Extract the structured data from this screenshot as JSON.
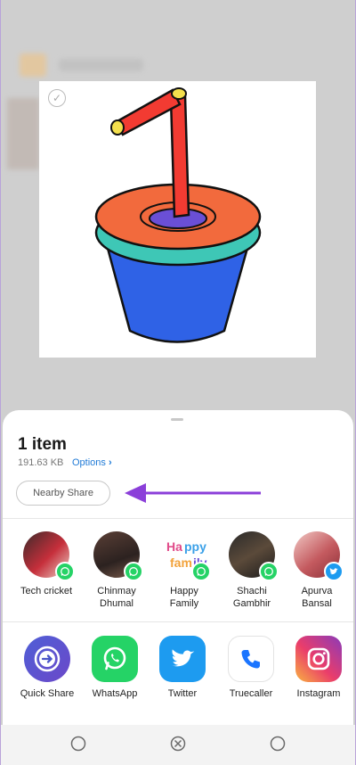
{
  "share_sheet": {
    "title": "1 item",
    "size": "191.63 KB",
    "options_label": "Options",
    "options_chevron": "›",
    "nearby_label": "Nearby Share"
  },
  "contacts": [
    {
      "line1": "Tech cricket",
      "line2": "",
      "badge": "whatsapp-icon",
      "badge_color": "#25d366"
    },
    {
      "line1": "Chinmay",
      "line2": "Dhumal",
      "badge": "whatsapp-icon",
      "badge_color": "#25d366"
    },
    {
      "line1": "Happy",
      "line2": "Family",
      "badge": "whatsapp-icon",
      "badge_color": "#25d366"
    },
    {
      "line1": "Shachi",
      "line2": "Gambhir",
      "badge": "whatsapp-icon",
      "badge_color": "#25d366"
    },
    {
      "line1": "Apurva",
      "line2": "Bansal",
      "badge": "twitter-icon",
      "badge_color": "#1d9bf0"
    }
  ],
  "apps": [
    {
      "label": "Quick Share",
      "icon": "quick-share-icon",
      "color": "#4a55c8"
    },
    {
      "label": "WhatsApp",
      "icon": "whatsapp-icon",
      "color": "#25d366"
    },
    {
      "label": "Twitter",
      "icon": "twitter-icon",
      "color": "#1d9bf0"
    },
    {
      "label": "Truecaller",
      "icon": "truecaller-icon",
      "color": "#ffffff"
    },
    {
      "label": "Instagram",
      "icon": "instagram-icon",
      "color": "#e1306c"
    }
  ]
}
